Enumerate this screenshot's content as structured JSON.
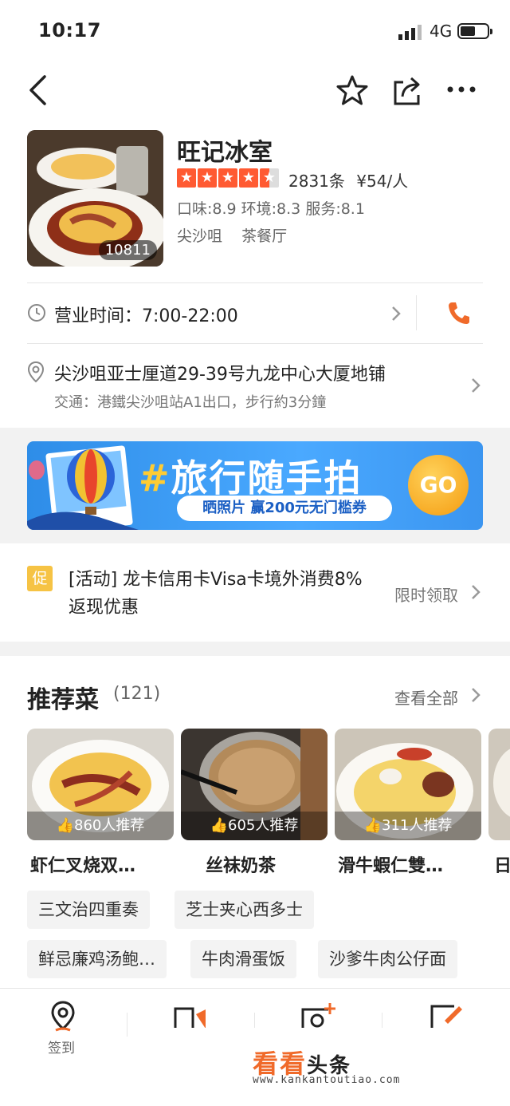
{
  "status_bar": {
    "time": "10:17",
    "network": "4G"
  },
  "shop": {
    "name": "旺记冰室",
    "photo_count": "10811",
    "rating": 4.5,
    "review_count": "2831条",
    "price": "¥54/人",
    "scores": "口味:8.9 环境:8.3 服务:8.1",
    "area": "尖沙咀",
    "category": "茶餐厅"
  },
  "hours": {
    "label": "营业时间：7:00-22:00"
  },
  "address": {
    "line": "尖沙咀亚士厘道29-39号九龙中心大厦地铺",
    "transit": "交通：港鐵尖沙咀站A1出口，步行約3分鐘"
  },
  "banner": {
    "hash": "#",
    "title": "旅行随手拍",
    "subtitle": "晒照片 赢200元无门槛券",
    "go_label": "GO"
  },
  "promo": {
    "tag": "促",
    "text_line1": "[活动] 龙卡信用卡Visa卡境外消费8%",
    "text_line2": "返现优惠",
    "action": "限时领取"
  },
  "recommended": {
    "title": "推荐菜",
    "count": "(121)",
    "view_all": "查看全部",
    "dishes": [
      {
        "name": "虾仁叉烧双…",
        "likes": "860人推荐"
      },
      {
        "name": "丝袜奶茶",
        "likes": "605人推荐"
      },
      {
        "name": "滑牛蝦仁雙…",
        "likes": "311人推荐"
      },
      {
        "name": "日"
      }
    ],
    "chips": [
      "三文治四重奏",
      "芝士夹心西多士",
      "鲜忌廉鸡汤鲍…",
      "牛肉滑蛋饭",
      "沙爹牛肉公仔面"
    ]
  },
  "toolbar": {
    "checkin_label": "签到"
  },
  "watermark": {
    "main": "看看",
    "suffix": "头条",
    "url": "www.kankantoutiao.com"
  },
  "colors": {
    "accent": "#ff5a32",
    "phone": "#f06a2a",
    "promo_tag": "#f6c344"
  }
}
